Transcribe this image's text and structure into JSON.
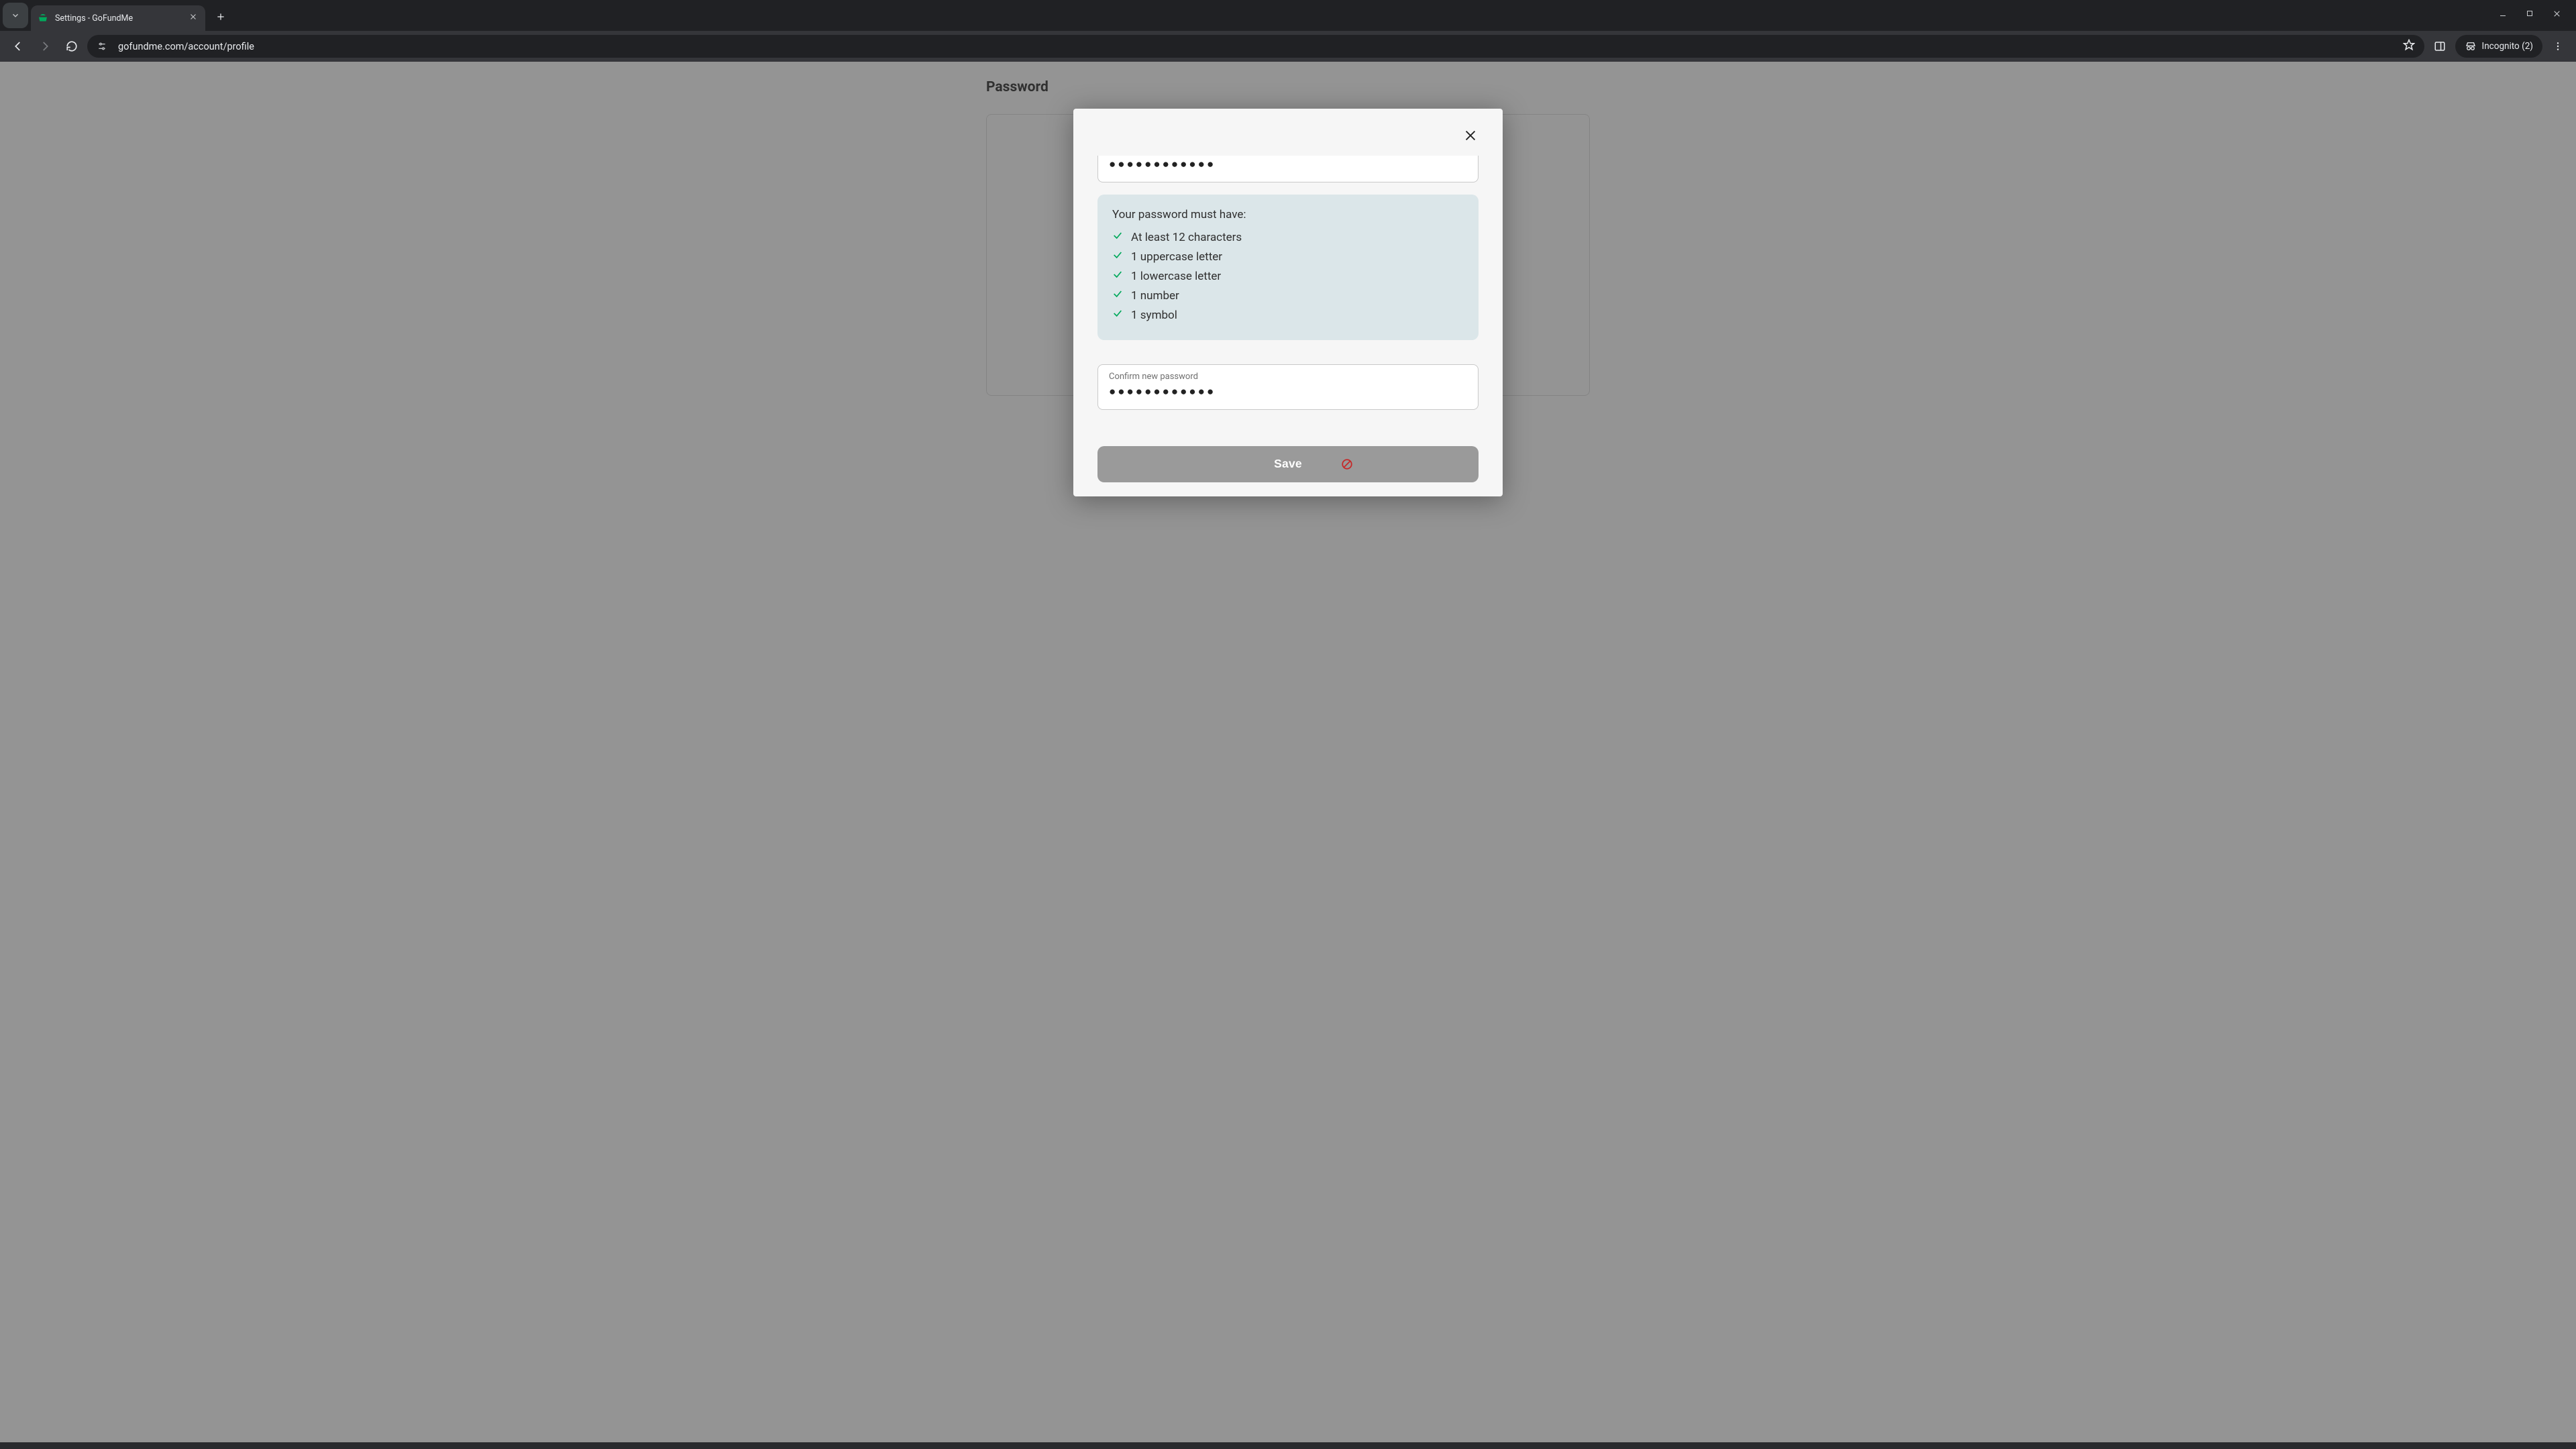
{
  "browser": {
    "tab_title": "Settings - GoFundMe",
    "url": "gofundme.com/account/profile",
    "incognito_label": "Incognito (2)"
  },
  "page": {
    "heading": "Password"
  },
  "modal": {
    "upper_password_value": "●●●●●●●●●●●●",
    "requirements_title": "Your password must have:",
    "requirements": {
      "r0": "At least 12 characters",
      "r1": "1 uppercase letter",
      "r2": "1 lowercase letter",
      "r3": "1 number",
      "r4": "1 symbol"
    },
    "confirm_label": "Confirm new password",
    "confirm_value": "●●●●●●●●●●●●",
    "save_label": "Save"
  }
}
